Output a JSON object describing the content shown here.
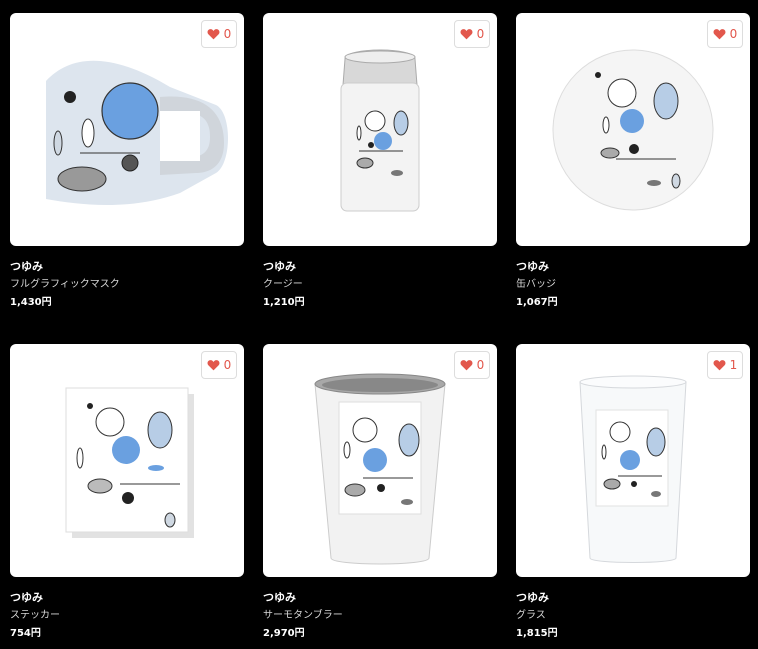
{
  "products": [
    {
      "shop": "つゆみ",
      "name": "フルグラフィックマスク",
      "price": "1,430円",
      "likes": "0"
    },
    {
      "shop": "つゆみ",
      "name": "クージー",
      "price": "1,210円",
      "likes": "0"
    },
    {
      "shop": "つゆみ",
      "name": "缶バッジ",
      "price": "1,067円",
      "likes": "0"
    },
    {
      "shop": "つゆみ",
      "name": "ステッカー",
      "price": "754円",
      "likes": "0"
    },
    {
      "shop": "つゆみ",
      "name": "サーモタンブラー",
      "price": "2,970円",
      "likes": "0"
    },
    {
      "shop": "つゆみ",
      "name": "グラス",
      "price": "1,815円",
      "likes": "1"
    }
  ],
  "icons": {
    "like": "heart-icon"
  },
  "colors": {
    "heart": "#e2574c",
    "accent_blue": "#6aa0e0"
  }
}
